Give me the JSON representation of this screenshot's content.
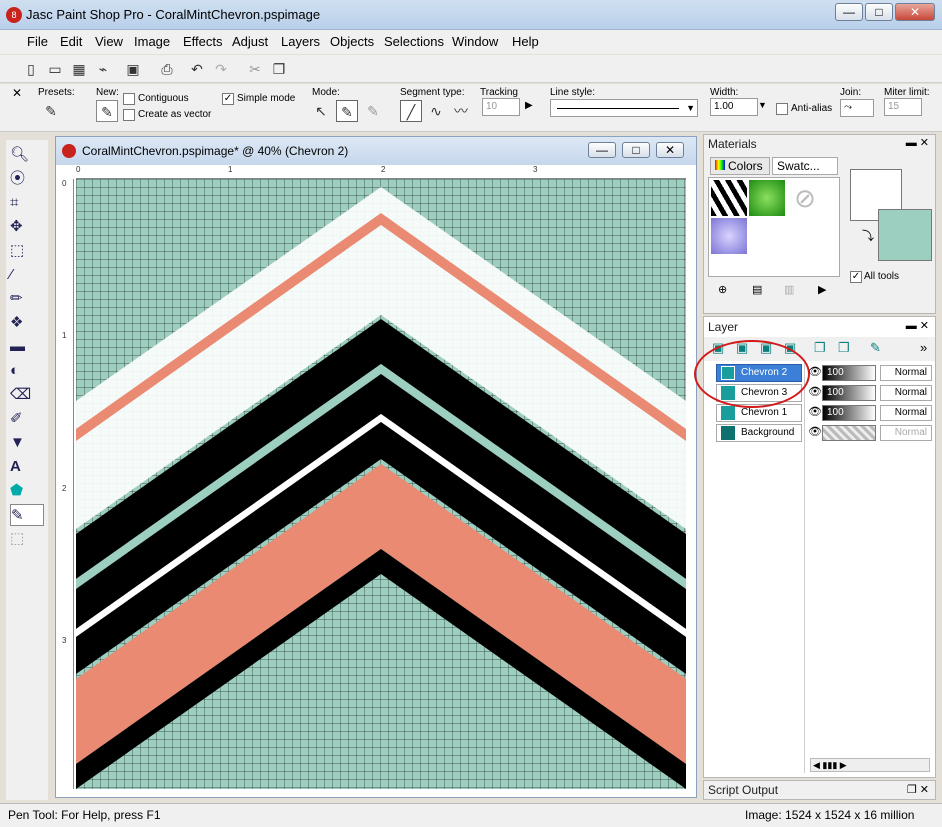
{
  "window": {
    "title": "Jasc Paint Shop Pro - CoralMintChevron.pspimage",
    "minimize": "—",
    "maximize": "□",
    "close": "✕"
  },
  "menu": [
    "File",
    "Edit",
    "View",
    "Image",
    "Effects",
    "Adjust",
    "Layers",
    "Objects",
    "Selections",
    "Window",
    "Help"
  ],
  "tooloptions": {
    "presets_label": "Presets:",
    "new_label": "New:",
    "contiguous_label": "Contiguous",
    "create_vector_label": "Create as vector",
    "simple_mode_label": "Simple mode",
    "simple_mode_checked": "✓",
    "mode_label": "Mode:",
    "segment_label": "Segment type:",
    "tracking_label": "Tracking",
    "tracking_value": "10",
    "linestyle_label": "Line style:",
    "width_label": "Width:",
    "width_value": "1.00",
    "antialias_label": "Anti-alias",
    "join_label": "Join:",
    "miter_label": "Miter limit:",
    "miter_value": "15"
  },
  "document": {
    "title": "CoralMintChevron.pspimage*  @  40% (Chevron 2)",
    "ruler_h": [
      "0",
      "1",
      "2",
      "3"
    ],
    "ruler_v": [
      "0",
      "1",
      "2",
      "3"
    ]
  },
  "chevron_colors": {
    "mint": "#9dcfc0",
    "white": "#ffffff",
    "coral": "#ea8a72",
    "black": "#000000"
  },
  "materials": {
    "title": "Materials",
    "tab_colors": "Colors",
    "tab_swatches": "Swatc...",
    "all_tools_label": "All tools",
    "all_tools_checked": "✓"
  },
  "layer": {
    "title": "Layer",
    "rows": [
      {
        "name": "Chevron 2",
        "opacity": "100",
        "blend": "Normal"
      },
      {
        "name": "Chevron 3",
        "opacity": "100",
        "blend": "Normal"
      },
      {
        "name": "Chevron 1",
        "opacity": "100",
        "blend": "Normal"
      },
      {
        "name": "Background",
        "opacity": "",
        "blend": "Normal"
      }
    ]
  },
  "script_output": {
    "title": "Script Output"
  },
  "status": {
    "help": "Pen Tool: For Help, press F1",
    "image": "Image:  1524 x 1524 x 16 million"
  }
}
